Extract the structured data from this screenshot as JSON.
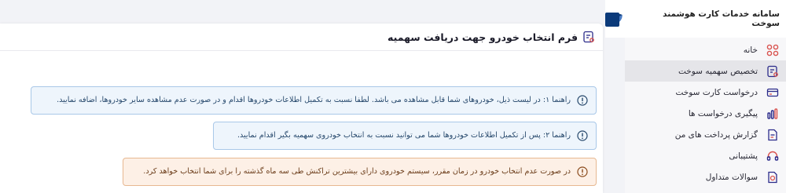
{
  "app": {
    "title": "سامانه خدمات کارت هوشمند سوخت",
    "brand_color": "#0b3a7a"
  },
  "sidebar": {
    "items": [
      {
        "label": "خانه",
        "icon": "grid-icon",
        "active": false
      },
      {
        "label": "تخصیص سهمیه سوخت",
        "icon": "form-icon",
        "active": true
      },
      {
        "label": "درخواست کارت سوخت",
        "icon": "card-icon",
        "active": false
      },
      {
        "label": "پیگیری درخواست ها",
        "icon": "bar-chart-icon",
        "active": false
      },
      {
        "label": "گزارش پرداخت های من",
        "icon": "document-icon",
        "active": false
      },
      {
        "label": "پشتیبانی",
        "icon": "headset-icon",
        "active": false
      },
      {
        "label": "سوالات متداول",
        "icon": "question-doc-icon",
        "active": false
      }
    ]
  },
  "main": {
    "title": "فرم انتخاب خودرو جهت دریافت سهمیه",
    "alerts": [
      {
        "type": "info",
        "text": "راهنما ۱: در لیست ذیل، خودروهای شما قابل مشاهده می باشد. لطفا نسبت به تکمیل اطلاعات خودروها اقدام و در صورت عدم مشاهده سایر خودروها، اضافه نمایید."
      },
      {
        "type": "info",
        "text": "راهنما ۲: پس از تکمیل اطلاعات خودروها شما می توانید نسبت به انتخاب خودروی سهمیه بگیر اقدام نمایید."
      },
      {
        "type": "warning",
        "text": "در صورت عدم انتخاب خودرو در زمان مقرر، سیستم خودروی دارای بیشترین تراکنش طی سه ماه گذشته را برای شما انتخاب خواهد کرد."
      }
    ]
  }
}
